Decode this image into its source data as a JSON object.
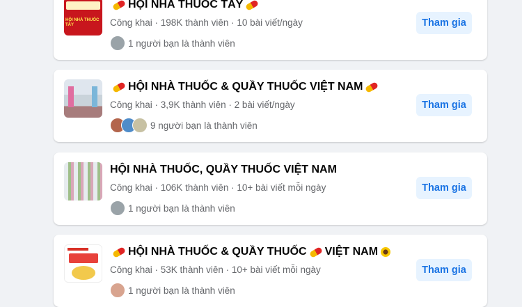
{
  "groups": [
    {
      "title": "HỘI NHÀ THUỐC TÂY",
      "thumb_text": "HỘI NHÀ THUỐC TÂY",
      "meta": "Công khai · 198K thành viên · 10 bài viết/ngày",
      "friends": "1 người bạn là thành viên",
      "join_label": "Tham gia"
    },
    {
      "title": "HỘI NHÀ THUỐC & QUẦY THUỐC VIỆT NAM",
      "meta": "Công khai · 3,9K thành viên · 2 bài viết/ngày",
      "friends": "9 người bạn là thành viên",
      "join_label": "Tham gia"
    },
    {
      "title": "HỘI NHÀ THUỐC, QUẦY THUỐC VIỆT NAM",
      "meta": "Công khai · 106K thành viên · 10+ bài viết mỗi ngày",
      "friends": "1 người bạn là thành viên",
      "join_label": "Tham gia"
    },
    {
      "title_part1": "HỘI NHÀ THUỐC & QUẦY THUỐC",
      "title_part2": "VIỆT NAM",
      "meta": "Công khai · 53K thành viên · 10+ bài viết mỗi ngày",
      "friends": "1 người bạn là thành viên",
      "join_label": "Tham gia"
    }
  ],
  "colors": {
    "background": "#f0f2f5",
    "card": "#ffffff",
    "button_bg": "#e7f3ff",
    "button_text": "#1b74e4",
    "title": "#050505",
    "secondary": "#65676b"
  },
  "icons": [
    "pill-emoji-icon",
    "sunflower-emoji-icon"
  ]
}
